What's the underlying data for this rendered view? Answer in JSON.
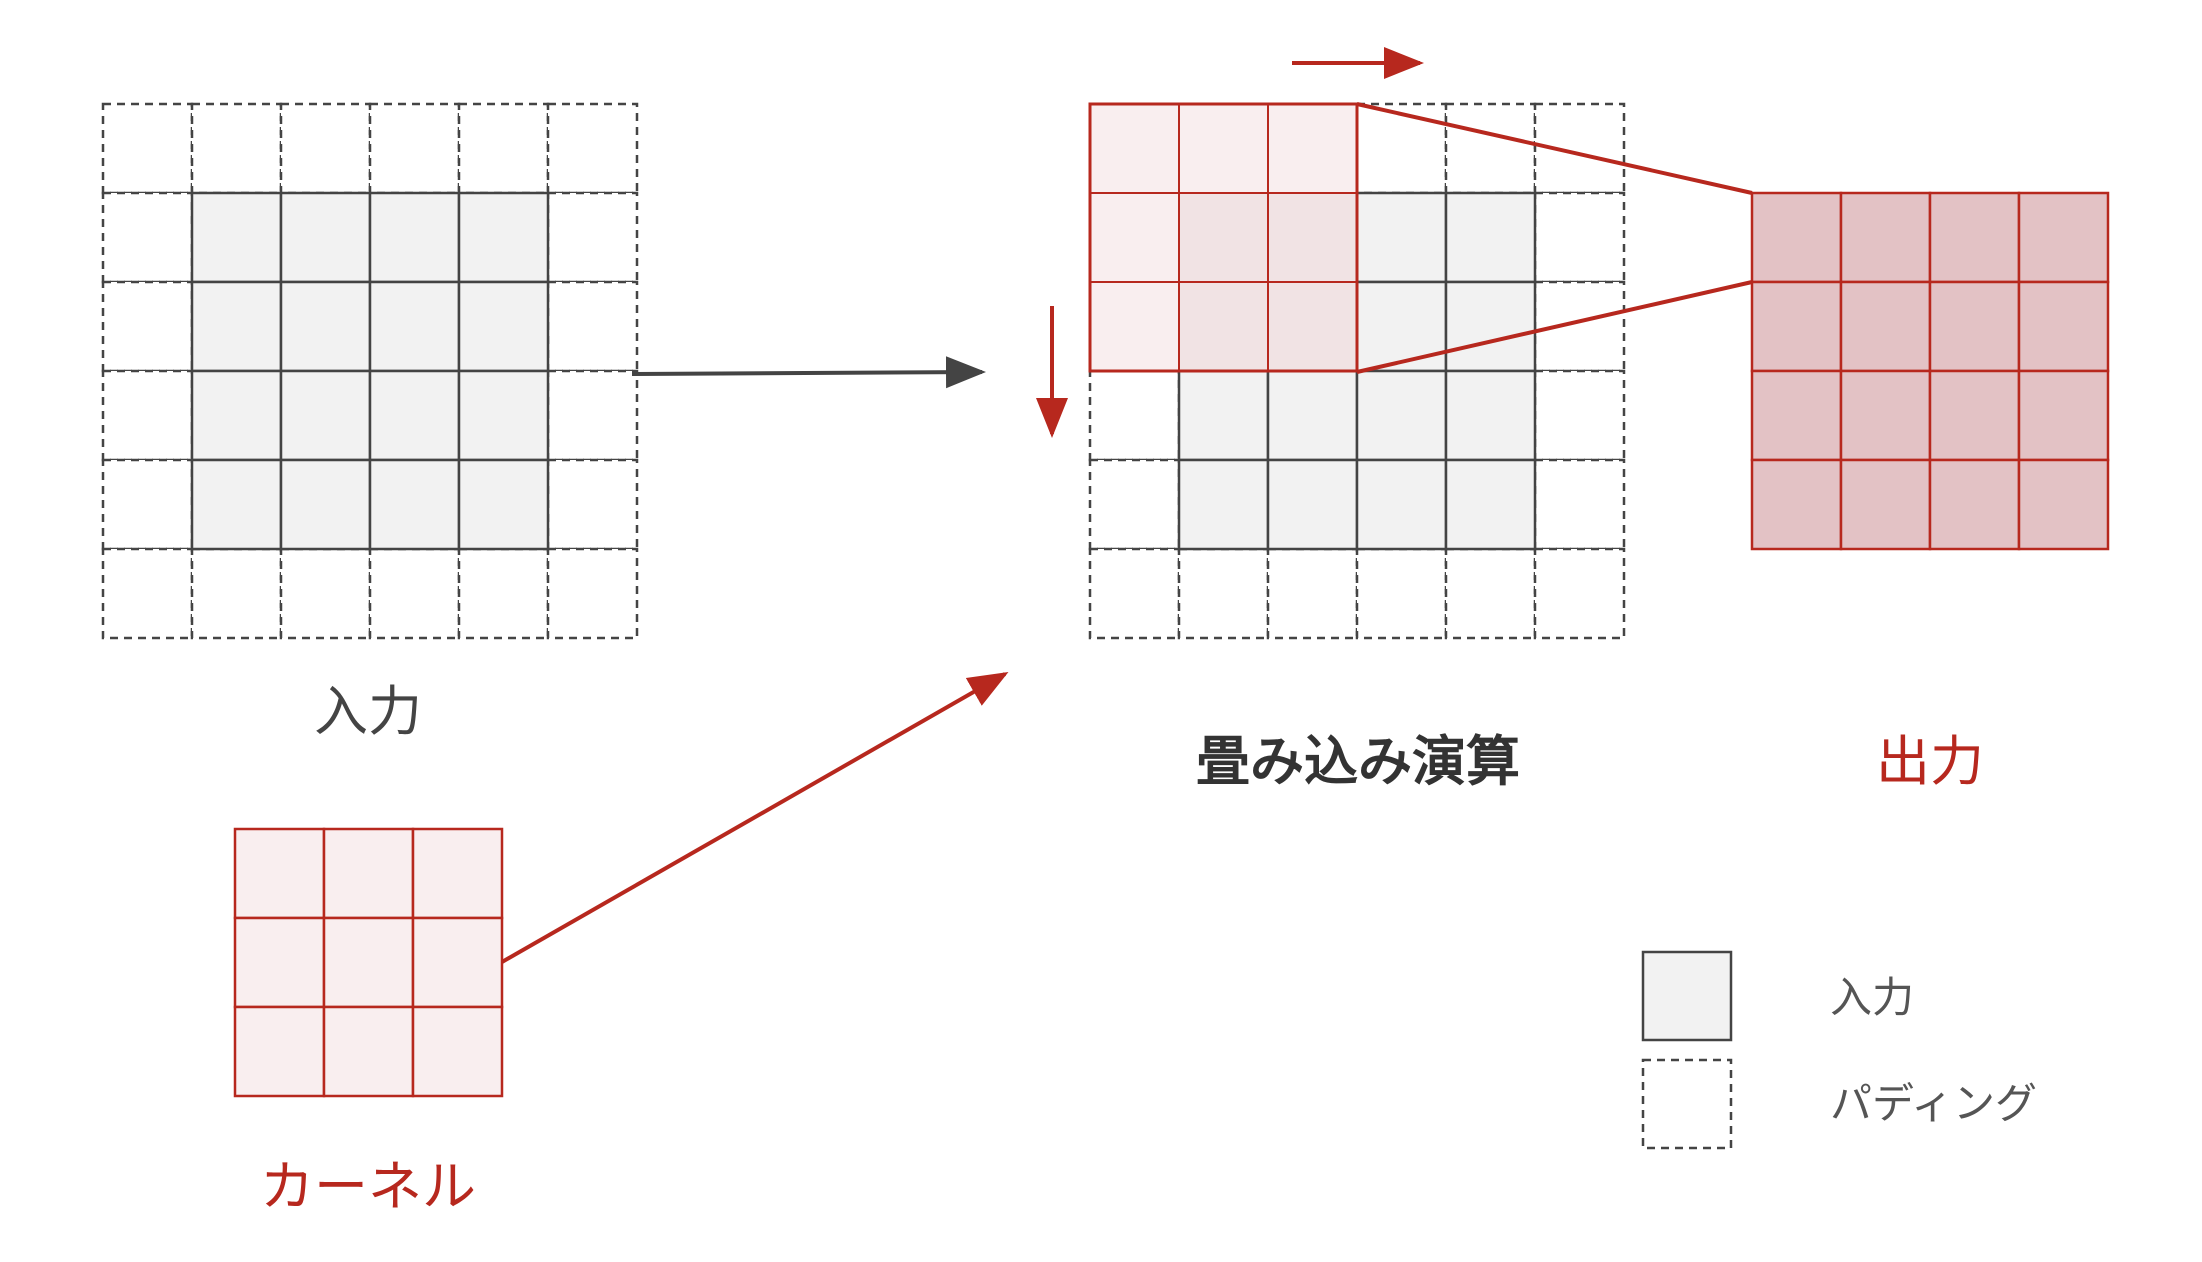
{
  "labels": {
    "input": "入力",
    "kernel": "カーネル",
    "convolution": "畳み込み演算",
    "output": "出力"
  },
  "legend": [
    {
      "label": "入力",
      "style": "input-cell"
    },
    {
      "label": "パディング",
      "style": "padding-cell"
    }
  ],
  "diagram": {
    "input_size": 4,
    "padding": 1,
    "kernel_size": 3,
    "output_size": 4
  },
  "colors": {
    "input_fill": "#f2f2f2",
    "grid_line": "#444444",
    "accent": "#b7281e",
    "kernel_fill": "#f9eeef",
    "overlap_fill": "#f1e3e4",
    "output_fill": "#e3c2c5",
    "arrow_dark": "#444444"
  }
}
